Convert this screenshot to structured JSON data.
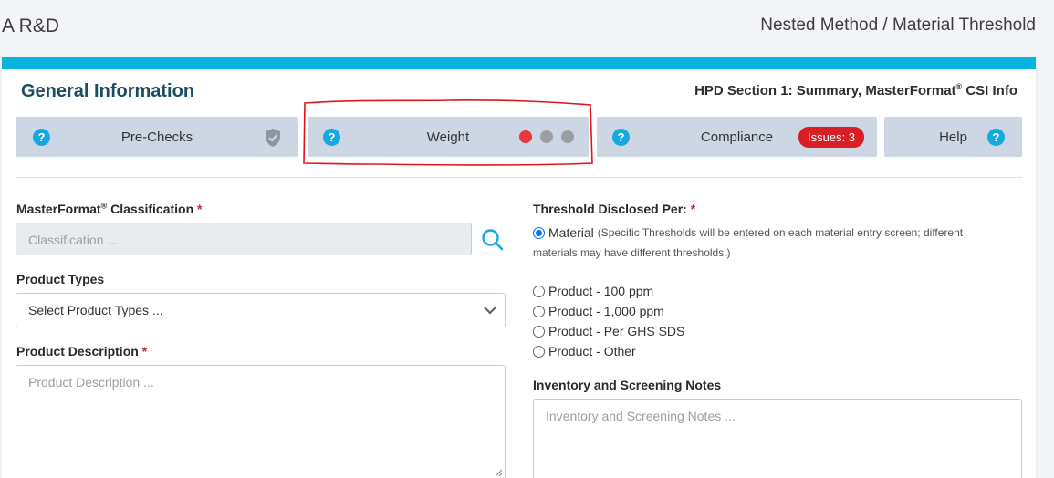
{
  "header": {
    "left_title": "A R&D",
    "breadcrumb": "Nested Method / Material Threshold"
  },
  "card": {
    "title": "General Information",
    "subtitle_pre": "HPD Section 1: Summary, MasterFormat",
    "subtitle_sup": "®",
    "subtitle_post": " CSI Info"
  },
  "steps": [
    {
      "label": "Pre-Checks",
      "status_icon": "shield-check-icon"
    },
    {
      "label": "Weight",
      "status_dots": [
        "#e8373d",
        "#9b9ea3",
        "#9b9ea3"
      ]
    },
    {
      "label": "Compliance",
      "badge": "Issues: 3"
    },
    {
      "label": "Help",
      "status_icon": "question-icon"
    }
  ],
  "help_glyph": "?",
  "required_mark": "*",
  "left": {
    "masterformat": {
      "label_pre": "MasterFormat",
      "label_sup": "®",
      "label_post": " Classification",
      "placeholder": "Classification ..."
    },
    "product_types": {
      "label": "Product Types",
      "value": "Select Product Types ..."
    },
    "product_description": {
      "label": "Product Description",
      "placeholder": "Product Description ..."
    }
  },
  "right": {
    "threshold": {
      "label": "Threshold Disclosed Per:",
      "options": [
        {
          "label": "Material",
          "note": "(Specific Thresholds will be entered on each material entry screen; different",
          "note2": "materials may have different thresholds.)",
          "checked": true
        },
        {
          "label": "Product - 100 ppm",
          "checked": false
        },
        {
          "label": "Product - 1,000 ppm",
          "checked": false
        },
        {
          "label": "Product - Per GHS SDS",
          "checked": false
        },
        {
          "label": "Product - Other",
          "checked": false
        }
      ]
    },
    "inventory": {
      "label": "Inventory and Screening Notes",
      "placeholder": "Inventory and Screening Notes ..."
    }
  },
  "colors": {
    "accent": "#0ab4e1",
    "help_blue": "#13a9e0",
    "step_bg": "#ccd7e3",
    "issue_red": "#d71f25",
    "annotation_red": "#e0141b"
  }
}
